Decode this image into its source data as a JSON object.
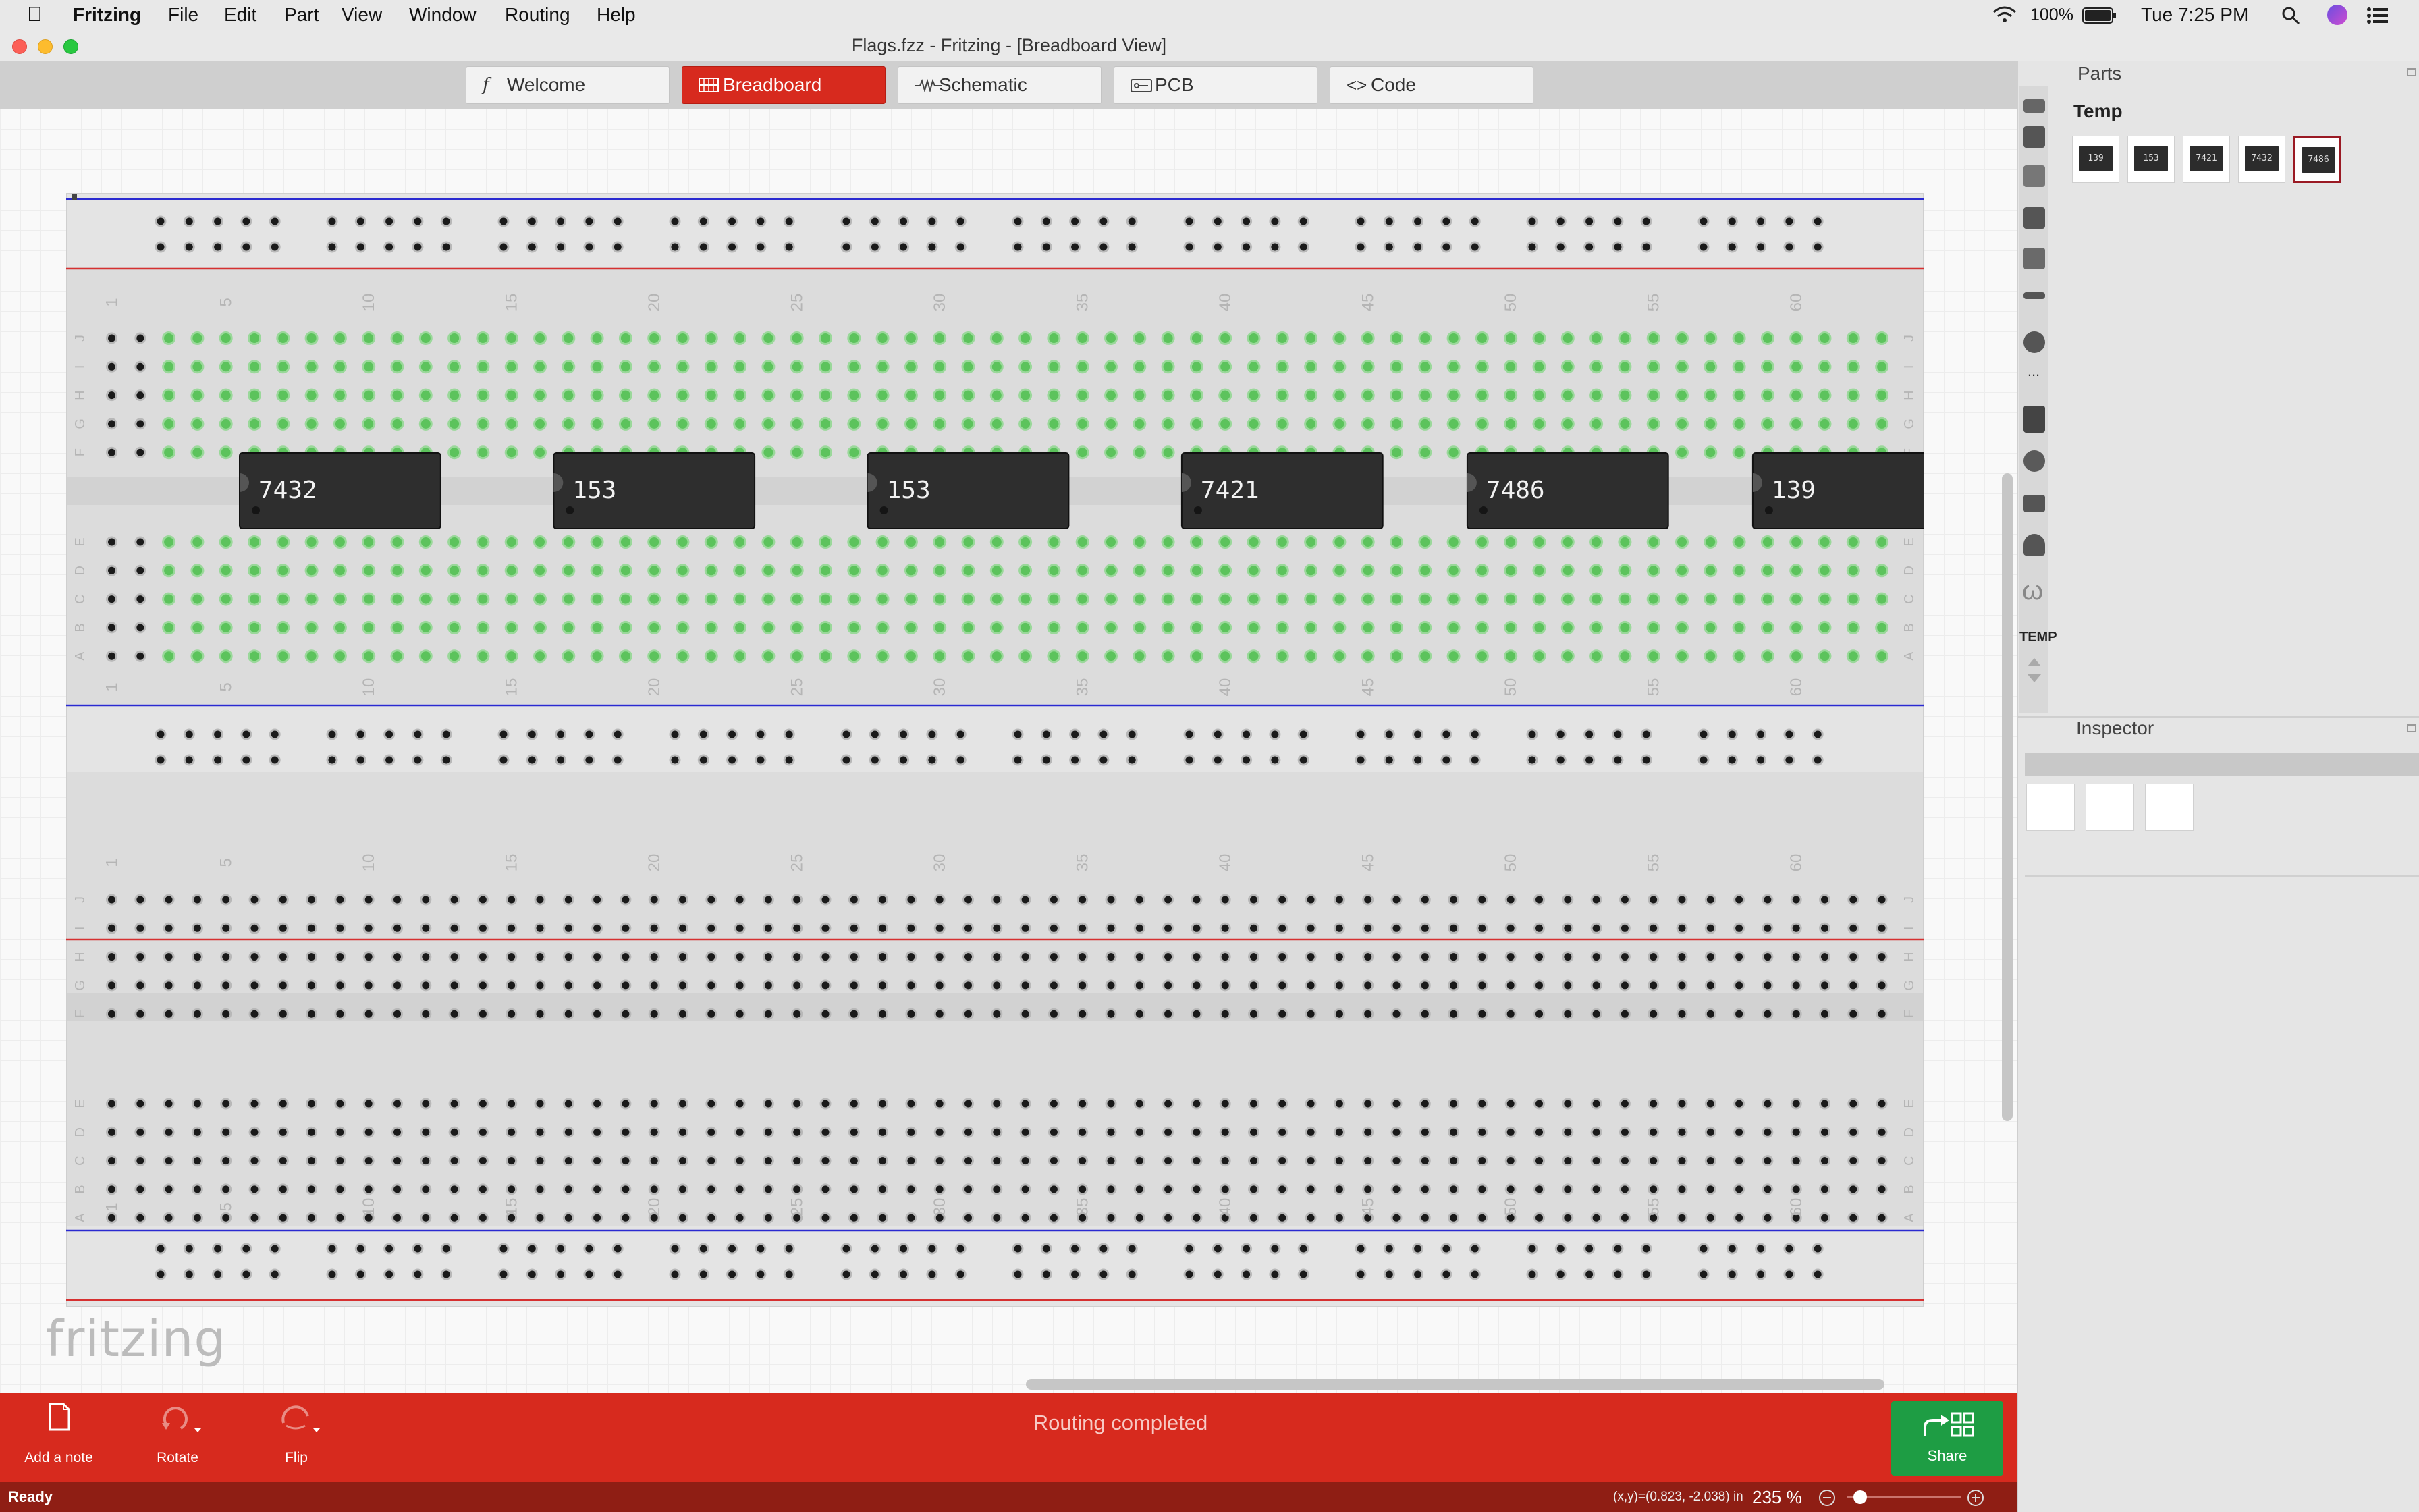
{
  "menubar": {
    "app_name": "Fritzing",
    "items": [
      "File",
      "Edit",
      "Part",
      "View",
      "Window",
      "Routing",
      "Help"
    ],
    "battery": "100%",
    "clock": "Tue 7:25 PM"
  },
  "window": {
    "title": "Flags.fzz - Fritzing - [Breadboard View]"
  },
  "tabs": [
    {
      "label": "Welcome",
      "icon": "fritzing-f-icon"
    },
    {
      "label": "Breadboard",
      "icon": "breadboard-icon",
      "active": true
    },
    {
      "label": "Schematic",
      "icon": "schematic-icon"
    },
    {
      "label": "PCB",
      "icon": "pcb-icon"
    },
    {
      "label": "Code",
      "icon": "code-icon"
    }
  ],
  "breadboard": {
    "column_labels": [
      "1",
      "5",
      "10",
      "15",
      "20",
      "25",
      "30",
      "35",
      "40",
      "45",
      "50",
      "55",
      "60"
    ],
    "row_letters_top": [
      "J",
      "I",
      "H",
      "G",
      "F"
    ],
    "row_letters_bottom": [
      "E",
      "D",
      "C",
      "B",
      "A"
    ],
    "chips": [
      "7432",
      "153",
      "153",
      "7421",
      "7486",
      "139"
    ]
  },
  "canvas": {
    "logo": "fritzing"
  },
  "toolbar": {
    "add_note": "Add a note",
    "rotate": "Rotate",
    "flip": "Flip",
    "routing_status": "Routing completed",
    "share": "Share"
  },
  "status": {
    "ready": "Ready",
    "coords": "(x,y)=(0.823, -2.038) in",
    "zoom": "235",
    "zoom_unit": "%"
  },
  "parts_panel": {
    "title": "Parts",
    "bin_name": "Temp",
    "bin_tab_label": "TEMP",
    "bin_more": "...",
    "parts": [
      "139",
      "153",
      "7421",
      "7432",
      "7486"
    ]
  },
  "inspector": {
    "title": "Inspector"
  },
  "colors": {
    "accent_red": "#d72a1e",
    "share_green": "#1e9d44",
    "status_dark_red": "#8f1e14",
    "hole_green": "#5cc35c",
    "rail_blue": "#2a2ad0",
    "rail_red": "#d63030"
  }
}
